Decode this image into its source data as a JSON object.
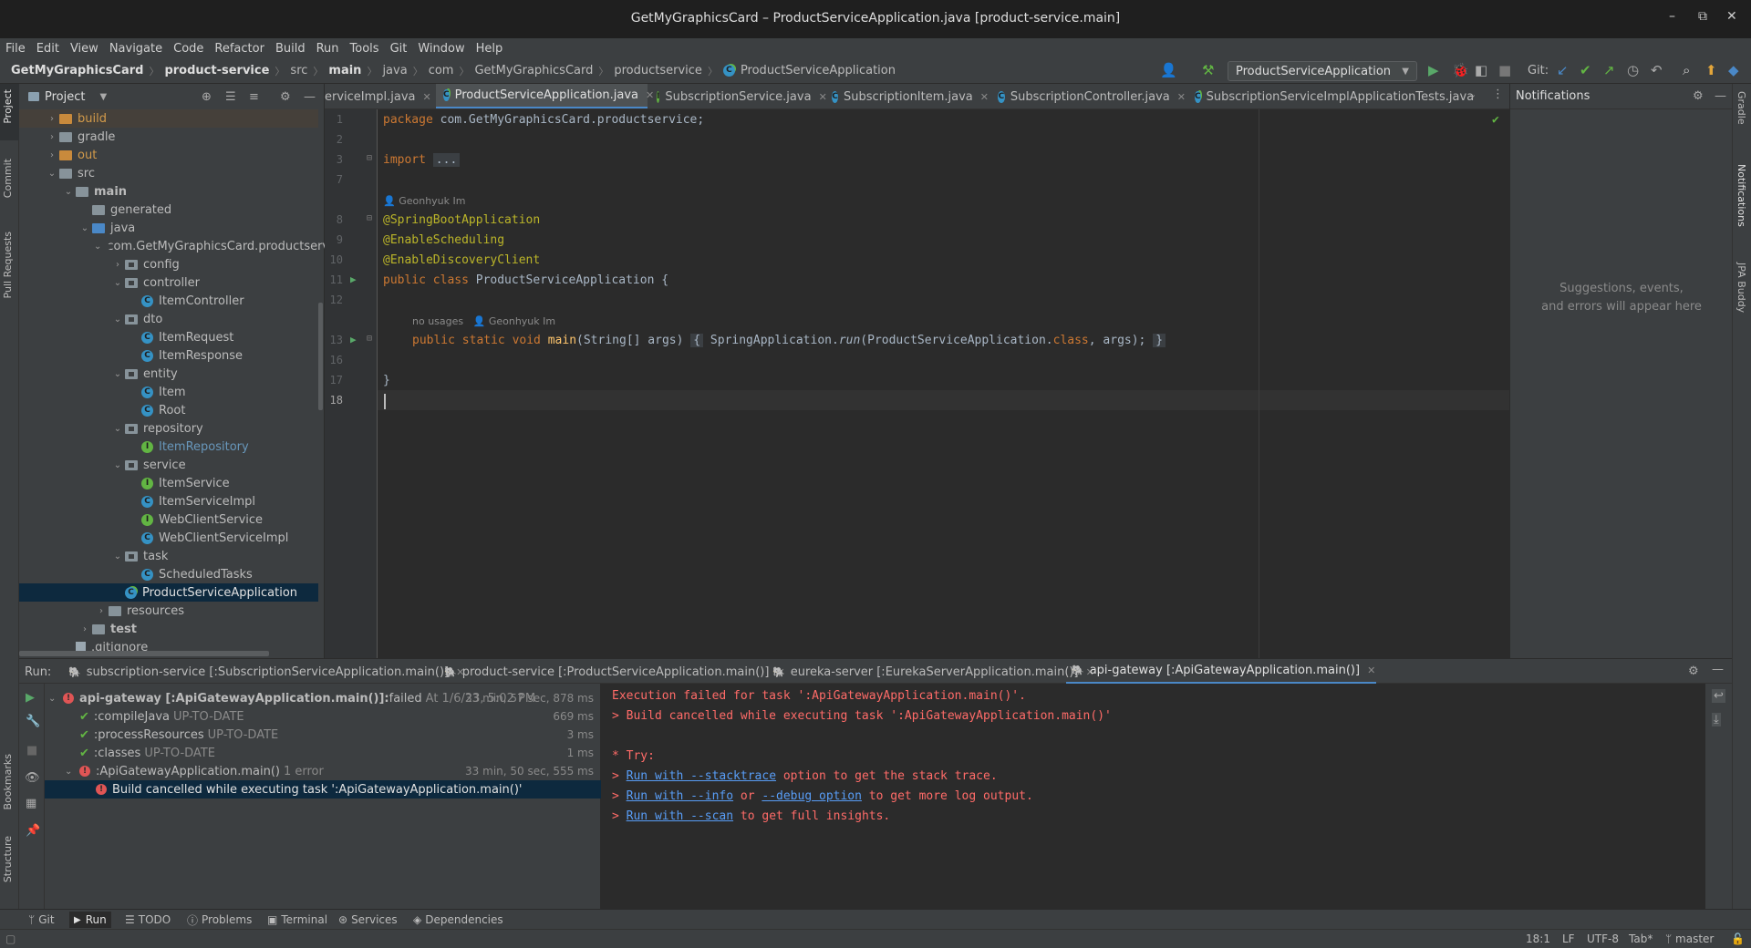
{
  "window": {
    "title": "GetMyGraphicsCard – ProductServiceApplication.java [product-service.main]",
    "controls": [
      "–",
      "⧉",
      "✕"
    ]
  },
  "menu": [
    "File",
    "Edit",
    "View",
    "Navigate",
    "Code",
    "Refactor",
    "Build",
    "Run",
    "Tools",
    "Git",
    "Window",
    "Help"
  ],
  "breadcrumbs": [
    "GetMyGraphicsCard",
    "product-service",
    "src",
    "main",
    "java",
    "com",
    "GetMyGraphicsCard",
    "productservice",
    "ProductServiceApplication"
  ],
  "toolbar": {
    "run_config": "ProductServiceApplication",
    "git_label": "Git:",
    "colors": {
      "run": "#59a869",
      "debug": "#499c54",
      "update": "#e2a53a"
    }
  },
  "left_strip": [
    "Project",
    "Commit",
    "Pull Requests",
    "Bookmarks",
    "Structure"
  ],
  "right_strip": [
    "Gradle",
    "Notifications",
    "JPA Buddy"
  ],
  "project": {
    "title": "Project",
    "tree": [
      {
        "label": "build",
        "arrow": "›",
        "icon": "folder-orange",
        "indent": 0,
        "color": "#d29a4a",
        "highlight": true
      },
      {
        "label": "gradle",
        "arrow": "›",
        "icon": "folder",
        "indent": 0
      },
      {
        "label": "out",
        "arrow": "›",
        "icon": "folder-orange",
        "indent": 0,
        "color": "#d29a4a"
      },
      {
        "label": "src",
        "arrow": "⌄",
        "icon": "folder",
        "indent": 0
      },
      {
        "label": "main",
        "arrow": "⌄",
        "icon": "folder",
        "indent": 1,
        "bold": true
      },
      {
        "label": "generated",
        "arrow": "",
        "icon": "folder",
        "indent": 2
      },
      {
        "label": "java",
        "arrow": "⌄",
        "icon": "folder-blue",
        "indent": 2
      },
      {
        "label": "com.GetMyGraphicsCard.productservice",
        "arrow": "⌄",
        "icon": "package",
        "indent": 3
      },
      {
        "label": "config",
        "arrow": "›",
        "icon": "package",
        "indent": 4
      },
      {
        "label": "controller",
        "arrow": "⌄",
        "icon": "package",
        "indent": 4
      },
      {
        "label": "ItemController",
        "arrow": "",
        "icon": "class",
        "indent": 5
      },
      {
        "label": "dto",
        "arrow": "⌄",
        "icon": "package",
        "indent": 4
      },
      {
        "label": "ItemRequest",
        "arrow": "",
        "icon": "class",
        "indent": 5
      },
      {
        "label": "ItemResponse",
        "arrow": "",
        "icon": "class",
        "indent": 5
      },
      {
        "label": "entity",
        "arrow": "⌄",
        "icon": "package",
        "indent": 4
      },
      {
        "label": "Item",
        "arrow": "",
        "icon": "class",
        "indent": 5
      },
      {
        "label": "Root",
        "arrow": "",
        "icon": "class",
        "indent": 5
      },
      {
        "label": "repository",
        "arrow": "⌄",
        "icon": "package",
        "indent": 4
      },
      {
        "label": "ItemRepository",
        "arrow": "",
        "icon": "interface",
        "indent": 5,
        "color": "#6897bb"
      },
      {
        "label": "service",
        "arrow": "⌄",
        "icon": "package",
        "indent": 4
      },
      {
        "label": "ItemService",
        "arrow": "",
        "icon": "interface",
        "indent": 5
      },
      {
        "label": "ItemServiceImpl",
        "arrow": "",
        "icon": "class",
        "indent": 5
      },
      {
        "label": "WebClientService",
        "arrow": "",
        "icon": "interface",
        "indent": 5
      },
      {
        "label": "WebClientServiceImpl",
        "arrow": "",
        "icon": "class",
        "indent": 5
      },
      {
        "label": "task",
        "arrow": "⌄",
        "icon": "package",
        "indent": 4
      },
      {
        "label": "ScheduledTasks",
        "arrow": "",
        "icon": "class",
        "indent": 5
      },
      {
        "label": "ProductServiceApplication",
        "arrow": "",
        "icon": "spring-class",
        "indent": 4,
        "selected": true
      },
      {
        "label": "resources",
        "arrow": "›",
        "icon": "folder",
        "indent": 3
      },
      {
        "label": "test",
        "arrow": "›",
        "icon": "folder",
        "indent": 2,
        "bold": true
      },
      {
        "label": ".gitignore",
        "arrow": "",
        "icon": "file",
        "indent": 1
      }
    ]
  },
  "editor_tabs": [
    {
      "label": "erviceImpl.java",
      "icon": "",
      "active": false
    },
    {
      "label": "ProductServiceApplication.java",
      "icon": "spring",
      "active": true
    },
    {
      "label": "SubscriptionService.java",
      "icon": "interface",
      "active": false
    },
    {
      "label": "SubscriptionItem.java",
      "icon": "class",
      "active": false
    },
    {
      "label": "SubscriptionController.java",
      "icon": "class",
      "active": false
    },
    {
      "label": "SubscriptionServiceImplApplicationTests.java",
      "icon": "spring",
      "active": false
    }
  ],
  "editor": {
    "line_numbers": [
      "1",
      "2",
      "3",
      "7",
      "8",
      "9",
      "10",
      "11",
      "12",
      "13",
      "16",
      "17",
      "18"
    ],
    "hints": {
      "author": "Geonhyuk Im",
      "usages": "no usages"
    },
    "code": {
      "l1_kw": "package",
      "l1_rest": " com.GetMyGraphicsCard.productservice;",
      "l3_kw": "import",
      "l3_fold": "...",
      "l8": "@SpringBootApplication",
      "l9": "@EnableScheduling",
      "l10": "@EnableDiscoveryClient",
      "l11_kw": "public class",
      "l11_rest": " ProductServiceApplication {",
      "l13_kw": "public static void",
      "l13_fn": "main",
      "l13_args": "(String[] args)",
      "l13_open": "{",
      "l13_body1": " SpringApplication.",
      "l13_run": "run",
      "l13_body2": "(ProductServiceApplication.",
      "l13_class": "class",
      "l13_body3": ", args);",
      "l13_close": "}",
      "l17": "}"
    }
  },
  "notifications": {
    "title": "Notifications",
    "empty_line1": "Suggestions, events,",
    "empty_line2": "and errors will appear here"
  },
  "run": {
    "label": "Run:",
    "tabs": [
      {
        "label": "subscription-service [:SubscriptionServiceApplication.main()]",
        "active": false
      },
      {
        "label": "product-service [:ProductServiceApplication.main()]",
        "active": false
      },
      {
        "label": "eureka-server [:EurekaServerApplication.main()]",
        "active": false
      },
      {
        "label": "api-gateway [:ApiGatewayApplication.main()]",
        "active": true
      }
    ],
    "tree": [
      {
        "status": "error",
        "text": "api-gateway [:ApiGatewayApplication.main()]:",
        "suffix": " failed",
        "meta": "At 1/6/23, 5:02 PM",
        "dur": "33 min, 57 sec, 878 ms",
        "indent": 0,
        "arrow": "⌄",
        "bold": true
      },
      {
        "status": "ok",
        "text": ":compileJava",
        "meta": "UP-TO-DATE",
        "dur": "669 ms",
        "indent": 1,
        "arrow": ""
      },
      {
        "status": "ok",
        "text": ":processResources",
        "meta": "UP-TO-DATE",
        "dur": "3 ms",
        "indent": 1,
        "arrow": ""
      },
      {
        "status": "ok",
        "text": ":classes",
        "meta": "UP-TO-DATE",
        "dur": "1 ms",
        "indent": 1,
        "arrow": ""
      },
      {
        "status": "error",
        "text": ":ApiGatewayApplication.main()",
        "meta": "1 error",
        "dur": "33 min, 50 sec, 555 ms",
        "indent": 1,
        "arrow": "⌄"
      },
      {
        "status": "error",
        "text": "Build cancelled while executing task ':ApiGatewayApplication.main()'",
        "meta": "",
        "dur": "",
        "indent": 2,
        "arrow": "",
        "selected": true
      }
    ],
    "console": {
      "l1": "Execution failed for task ':ApiGatewayApplication.main()'.",
      "l2": "> Build cancelled while executing task ':ApiGatewayApplication.main()'",
      "l3": "* Try:",
      "l4_pre": "> ",
      "l4_link": "Run with --stacktrace",
      "l4_post": " option to get the stack trace.",
      "l5_pre": "> ",
      "l5_link1": "Run with --info",
      "l5_mid": " or ",
      "l5_link2": "--debug option",
      "l5_post": " to get more log output.",
      "l6_pre": "> ",
      "l6_link": "Run with --scan",
      "l6_post": " to get full insights."
    }
  },
  "bottom_tabs": [
    "Git",
    "Run",
    "TODO",
    "Problems",
    "Terminal",
    "Services",
    "Dependencies"
  ],
  "status": {
    "position": "18:1",
    "line_sep": "LF",
    "encoding": "UTF-8",
    "indent": "Tab*",
    "branch": "master"
  }
}
